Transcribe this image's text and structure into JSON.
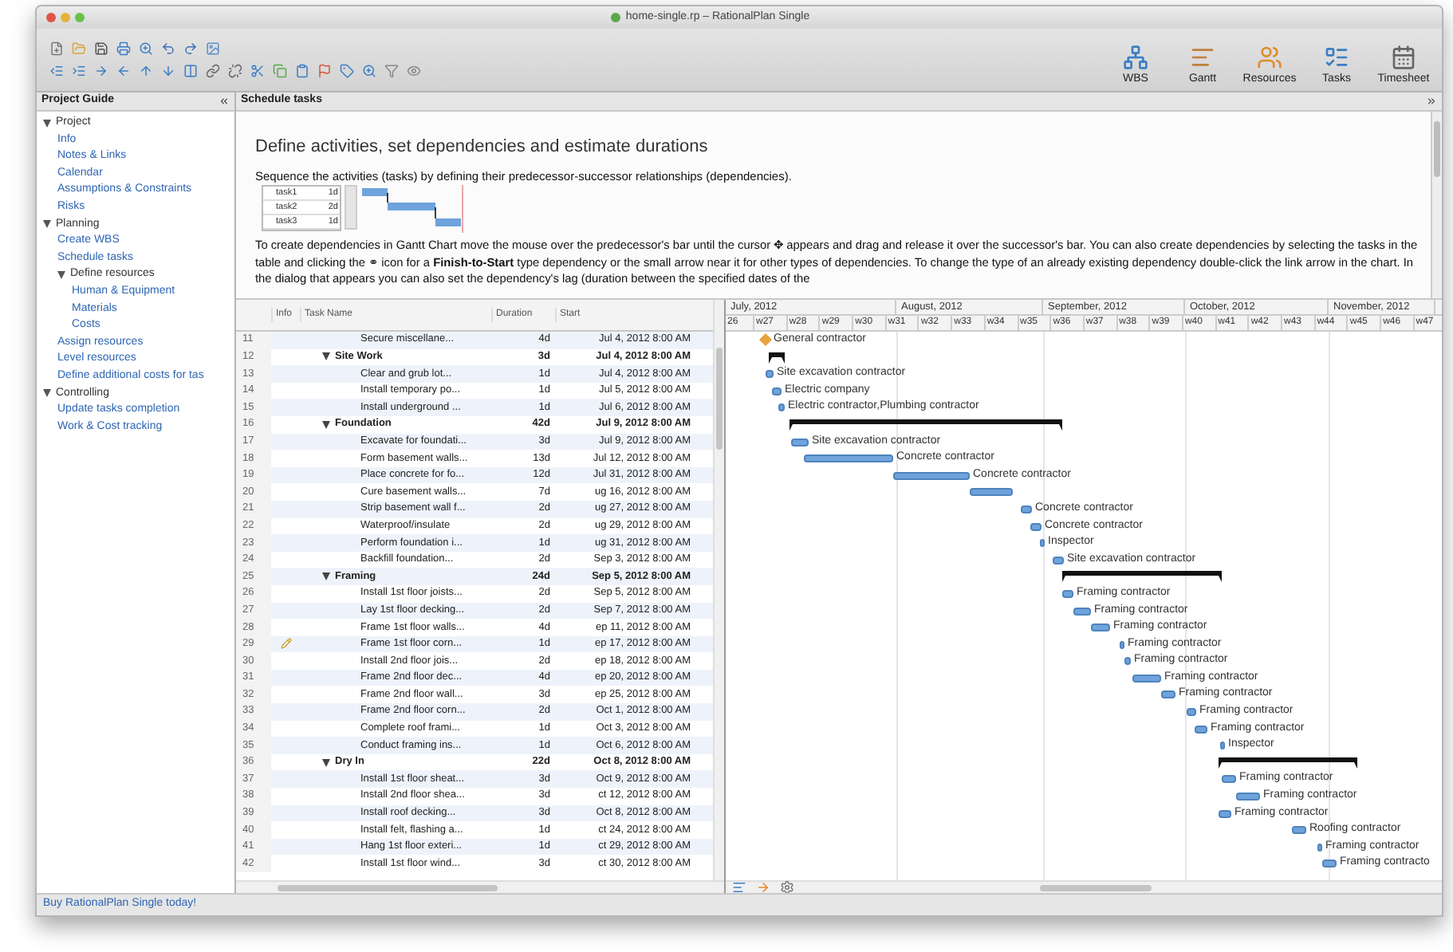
{
  "window": {
    "title": "home-single.rp – RationalPlan Single"
  },
  "toolbar": {
    "views": [
      {
        "label": "WBS",
        "kind": "wbs"
      },
      {
        "label": "Gantt",
        "kind": "gantt"
      },
      {
        "label": "Resources",
        "kind": "resources"
      },
      {
        "label": "Tasks",
        "kind": "tasks"
      },
      {
        "label": "Timesheet",
        "kind": "timesheet"
      }
    ]
  },
  "project_guide": {
    "title": "Project Guide",
    "items": [
      {
        "label": "Project",
        "expanded": true,
        "children": [
          {
            "label": "Info"
          },
          {
            "label": "Notes & Links"
          },
          {
            "label": "Calendar"
          },
          {
            "label": "Assumptions & Constraints"
          },
          {
            "label": "Risks"
          }
        ]
      },
      {
        "label": "Planning",
        "expanded": true,
        "children": [
          {
            "label": "Create WBS"
          },
          {
            "label": "Schedule tasks"
          },
          {
            "label": "Define resources",
            "expanded": true,
            "children": [
              {
                "label": "Human & Equipment"
              },
              {
                "label": "Materials"
              },
              {
                "label": "Costs"
              }
            ]
          },
          {
            "label": "Assign resources"
          },
          {
            "label": "Level resources"
          },
          {
            "label": "Define additional costs for tas"
          }
        ]
      },
      {
        "label": "Controlling",
        "expanded": true,
        "children": [
          {
            "label": "Update tasks completion"
          },
          {
            "label": "Work & Cost tracking"
          }
        ]
      }
    ]
  },
  "schedule_panel": {
    "title": "Schedule tasks",
    "heading": "Define activities, set dependencies and estimate durations",
    "intro": "Sequence the activities (tasks) by defining their predecessor-successor relationships (dependencies).",
    "example": {
      "rows": [
        {
          "name": "task1",
          "duration": "1d"
        },
        {
          "name": "task2",
          "duration": "2d"
        },
        {
          "name": "task3",
          "duration": "1d"
        }
      ]
    },
    "body": "To create dependencies in Gantt Chart move the mouse over the predecessor's bar until the cursor ✥ appears and drag and release it over the successor's bar. You can also create dependencies by selecting the tasks in the table and clicking the ⚭ icon for a **Finish-to-Start** type dependency or the small arrow near it for other types of dependencies. To change the type of an already existing dependency double-click the link arrow in the chart. In the dialog that appears you can also set the dependency's lag (duration between the specified dates of the"
  },
  "table": {
    "columns": [
      "Info",
      "Task Name",
      "Duration",
      "Start"
    ],
    "rows": [
      {
        "id": "11",
        "name": "Secure miscellane...",
        "duration": "4d",
        "start": "Jul 4, 2012 8:00 AM",
        "kind": "task"
      },
      {
        "id": "12",
        "name": "Site Work",
        "duration": "3d",
        "start": "Jul 4, 2012 8:00 AM",
        "kind": "summary",
        "expanded": true,
        "children": [
          {
            "id": "13",
            "name": "Clear and grub lot...",
            "duration": "1d",
            "start": "Jul 4, 2012 8:00 AM",
            "kind": "task"
          },
          {
            "id": "14",
            "name": "Install temporary po...",
            "duration": "1d",
            "start": "Jul 5, 2012 8:00 AM",
            "kind": "task"
          },
          {
            "id": "15",
            "name": "Install underground ...",
            "duration": "1d",
            "start": "Jul 6, 2012 8:00 AM",
            "kind": "task"
          }
        ]
      },
      {
        "id": "16",
        "name": "Foundation",
        "duration": "42d",
        "start": "Jul 9, 2012 8:00 AM",
        "kind": "summary",
        "expanded": true,
        "children": [
          {
            "id": "17",
            "name": "Excavate for foundati...",
            "duration": "3d",
            "start": "Jul 9, 2012 8:00 AM",
            "kind": "task"
          },
          {
            "id": "18",
            "name": "Form basement walls...",
            "duration": "13d",
            "start": "Jul 12, 2012 8:00 AM",
            "kind": "task"
          },
          {
            "id": "19",
            "name": "Place concrete for fo...",
            "duration": "12d",
            "start": "Jul 31, 2012 8:00 AM",
            "kind": "task"
          },
          {
            "id": "20",
            "name": "Cure basement walls...",
            "duration": "7d",
            "start": "ug 16, 2012 8:00 AM",
            "kind": "task"
          },
          {
            "id": "21",
            "name": "Strip basement wall f...",
            "duration": "2d",
            "start": "ug 27, 2012 8:00 AM",
            "kind": "task"
          },
          {
            "id": "22",
            "name": "Waterproof/insulate",
            "duration": "2d",
            "start": "ug 29, 2012 8:00 AM",
            "kind": "task"
          },
          {
            "id": "23",
            "name": "Perform foundation i...",
            "duration": "1d",
            "start": "ug 31, 2012 8:00 AM",
            "kind": "task"
          },
          {
            "id": "24",
            "name": "Backfill foundation...",
            "duration": "2d",
            "start": "Sep 3, 2012 8:00 AM",
            "kind": "task"
          }
        ]
      },
      {
        "id": "25",
        "name": "Framing",
        "duration": "24d",
        "start": "Sep 5, 2012 8:00 AM",
        "kind": "summary",
        "expanded": true,
        "children": [
          {
            "id": "26",
            "name": "Install 1st floor joists...",
            "duration": "2d",
            "start": "Sep 5, 2012 8:00 AM",
            "kind": "task"
          },
          {
            "id": "27",
            "name": "Lay 1st floor decking...",
            "duration": "2d",
            "start": "Sep 7, 2012 8:00 AM",
            "kind": "task"
          },
          {
            "id": "28",
            "name": "Frame 1st floor walls...",
            "duration": "4d",
            "start": "ep 11, 2012 8:00 AM",
            "kind": "task"
          },
          {
            "id": "29",
            "name": "Frame 1st floor corn...",
            "duration": "1d",
            "start": "ep 17, 2012 8:00 AM",
            "kind": "task",
            "note": true
          },
          {
            "id": "30",
            "name": "Install 2nd floor jois...",
            "duration": "2d",
            "start": "ep 18, 2012 8:00 AM",
            "kind": "task"
          },
          {
            "id": "31",
            "name": "Frame 2nd floor dec...",
            "duration": "4d",
            "start": "ep 20, 2012 8:00 AM",
            "kind": "task"
          },
          {
            "id": "32",
            "name": "Frame 2nd floor wall...",
            "duration": "3d",
            "start": "ep 25, 2012 8:00 AM",
            "kind": "task"
          },
          {
            "id": "33",
            "name": "Frame 2nd floor corn...",
            "duration": "2d",
            "start": "Oct 1, 2012 8:00 AM",
            "kind": "task"
          },
          {
            "id": "34",
            "name": "Complete roof frami...",
            "duration": "1d",
            "start": "Oct 3, 2012 8:00 AM",
            "kind": "task"
          },
          {
            "id": "35",
            "name": "Conduct framing ins...",
            "duration": "1d",
            "start": "Oct 6, 2012 8:00 AM",
            "kind": "task"
          }
        ]
      },
      {
        "id": "36",
        "name": "Dry In",
        "duration": "22d",
        "start": "Oct 8, 2012 8:00 AM",
        "kind": "summary",
        "expanded": true,
        "children": [
          {
            "id": "37",
            "name": "Install 1st floor sheat...",
            "duration": "3d",
            "start": "Oct 9, 2012 8:00 AM",
            "kind": "task"
          },
          {
            "id": "38",
            "name": "Install 2nd floor shea...",
            "duration": "3d",
            "start": "ct 12, 2012 8:00 AM",
            "kind": "task"
          },
          {
            "id": "39",
            "name": "Install roof decking...",
            "duration": "3d",
            "start": "Oct 8, 2012 8:00 AM",
            "kind": "task"
          },
          {
            "id": "40",
            "name": "Install felt, flashing a...",
            "duration": "1d",
            "start": "ct 24, 2012 8:00 AM",
            "kind": "task"
          },
          {
            "id": "41",
            "name": "Hang 1st floor exteri...",
            "duration": "1d",
            "start": "ct 29, 2012 8:00 AM",
            "kind": "task"
          },
          {
            "id": "42",
            "name": "Install 1st floor wind...",
            "duration": "3d",
            "start": "ct 30, 2012 8:00 AM",
            "kind": "task"
          }
        ]
      }
    ]
  },
  "gantt": {
    "months": [
      "July, 2012",
      "August, 2012",
      "September, 2012",
      "October, 2012",
      "November, 2012"
    ],
    "weeks": [
      "26",
      "w27",
      "w28",
      "w29",
      "w30",
      "w31",
      "w32",
      "w33",
      "w34",
      "w35",
      "w36",
      "w37",
      "w38",
      "w39",
      "w40",
      "w41",
      "w42",
      "w43",
      "w44",
      "w45",
      "w46",
      "w47"
    ],
    "rows": [
      {
        "kind": "milestone",
        "label": "General contractor"
      },
      {
        "kind": "summary"
      },
      {
        "kind": "task",
        "label": "Site excavation contractor"
      },
      {
        "kind": "task",
        "label": "Electric company"
      },
      {
        "kind": "task",
        "label": "Electric contractor,Plumbing contractor"
      },
      {
        "kind": "summary"
      },
      {
        "kind": "task",
        "label": "Site excavation contractor"
      },
      {
        "kind": "task",
        "label": "Concrete contractor"
      },
      {
        "kind": "task",
        "label": "Concrete contractor"
      },
      {
        "kind": "task"
      },
      {
        "kind": "task",
        "label": "Concrete contractor"
      },
      {
        "kind": "task",
        "label": "Concrete contractor"
      },
      {
        "kind": "task",
        "label": "Inspector"
      },
      {
        "kind": "task",
        "label": "Site excavation contractor"
      },
      {
        "kind": "summary"
      },
      {
        "kind": "task",
        "label": "Framing contractor"
      },
      {
        "kind": "task",
        "label": "Framing contractor"
      },
      {
        "kind": "task",
        "label": "Framing contractor"
      },
      {
        "kind": "task",
        "label": "Framing contractor"
      },
      {
        "kind": "task",
        "label": "Framing contractor"
      },
      {
        "kind": "task",
        "label": "Framing contractor"
      },
      {
        "kind": "task",
        "label": "Framing contractor"
      },
      {
        "kind": "task",
        "label": "Framing contractor"
      },
      {
        "kind": "task",
        "label": "Framing contractor"
      },
      {
        "kind": "task",
        "label": "Inspector"
      },
      {
        "kind": "summary"
      },
      {
        "kind": "task",
        "label": "Framing contractor"
      },
      {
        "kind": "task",
        "label": "Framing contractor"
      },
      {
        "kind": "task",
        "label": "Framing contractor"
      },
      {
        "kind": "task",
        "label": "Roofing contractor"
      },
      {
        "kind": "task",
        "label": "Framing contractor"
      },
      {
        "kind": "task",
        "label": "Framing contracto"
      }
    ]
  },
  "status_bar": {
    "text": "Buy RationalPlan Single today!"
  }
}
